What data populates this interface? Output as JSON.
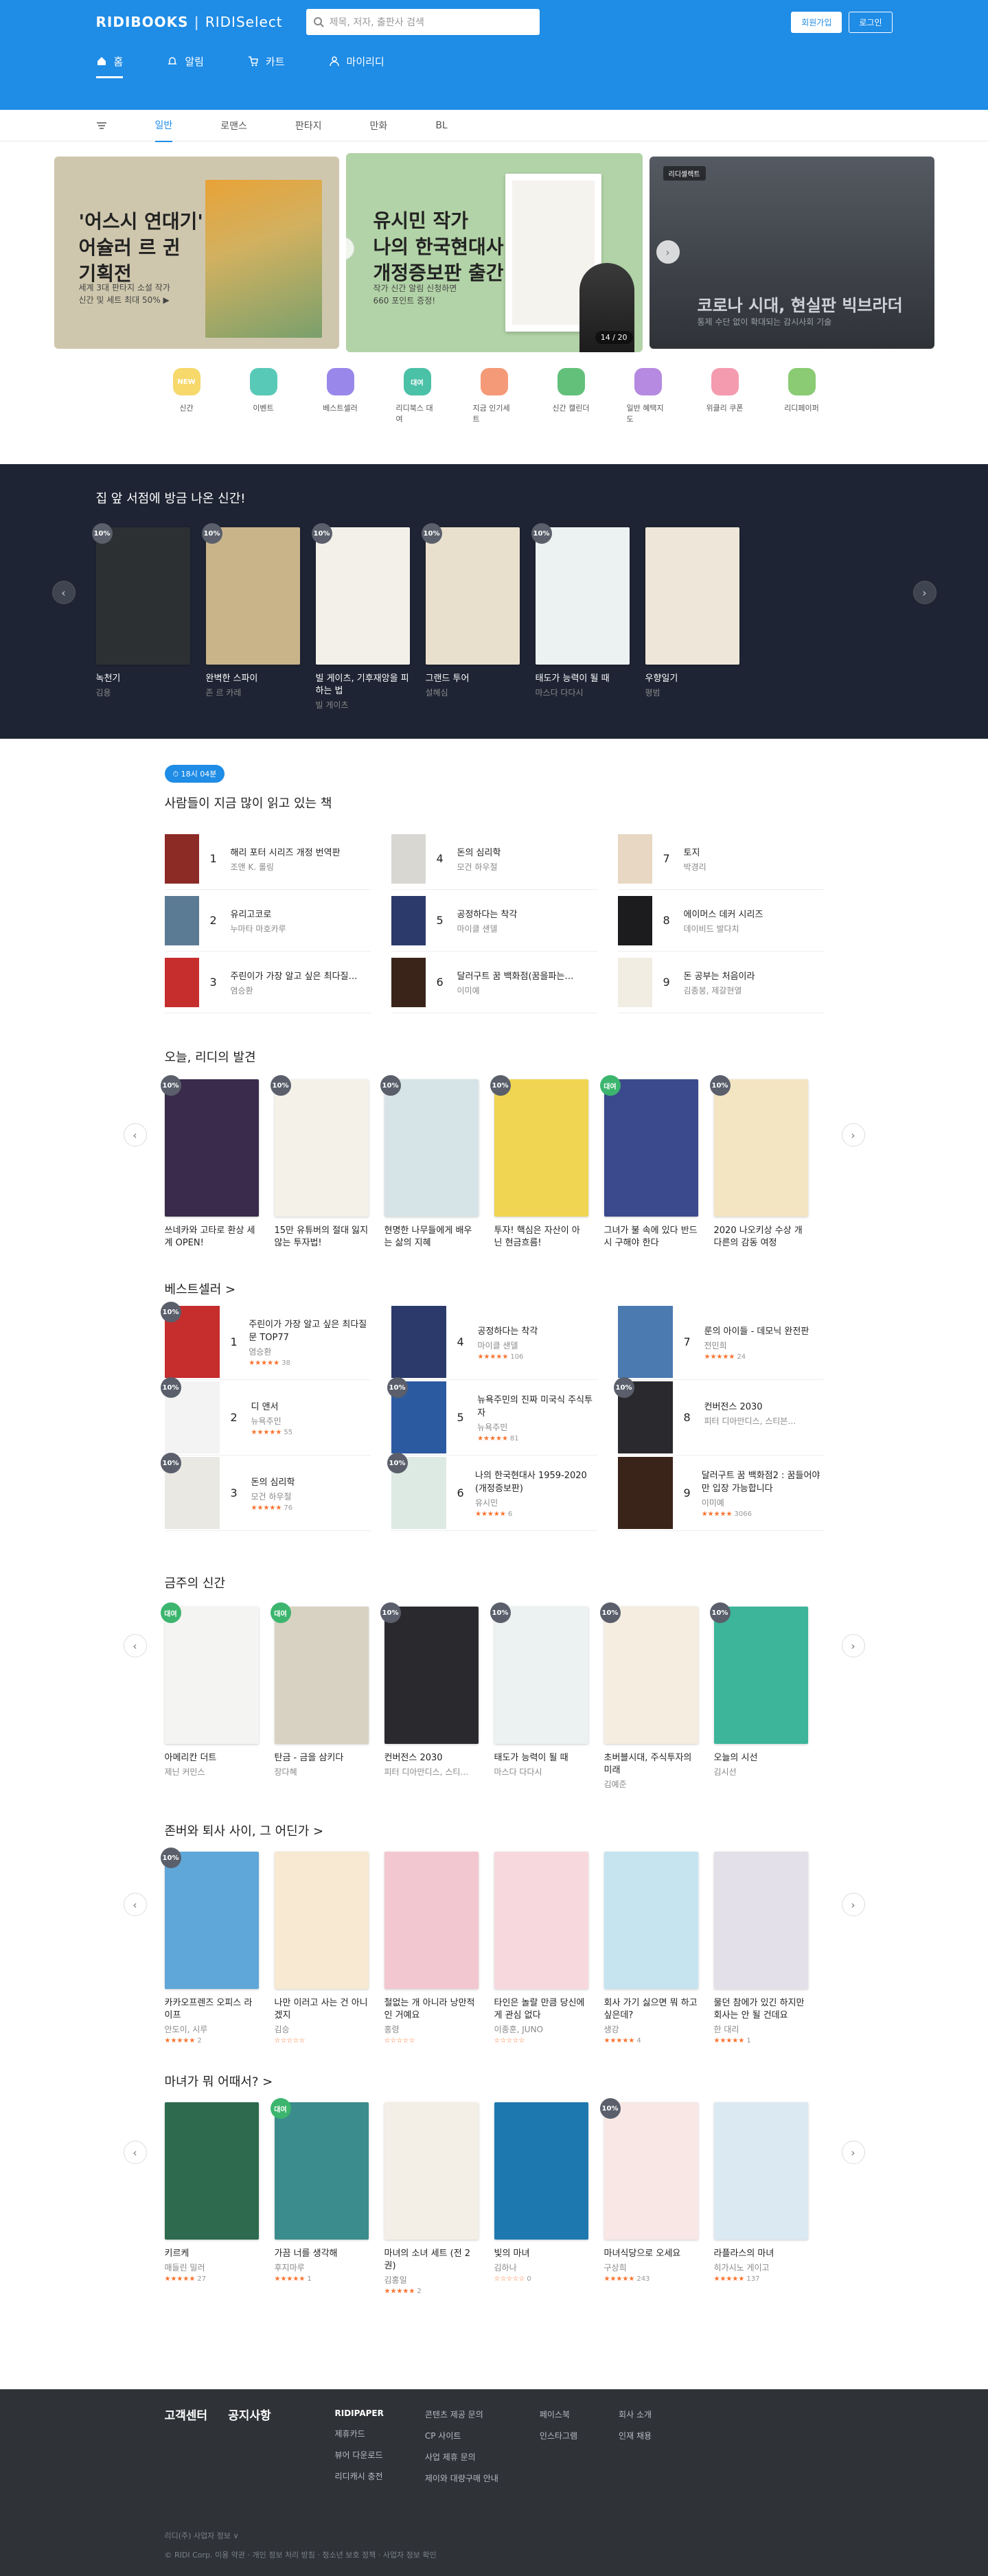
{
  "header": {
    "logo": "RIDIBOOKS",
    "logo2": "RIDISelect",
    "search_placeholder": "제목, 저자, 출판사 검색",
    "signup": "회원가입",
    "login": "로그인"
  },
  "gnb": [
    {
      "label": "홈",
      "icon": "home-icon"
    },
    {
      "label": "알림",
      "icon": "bell-icon"
    },
    {
      "label": "카트",
      "icon": "cart-icon"
    },
    {
      "label": "마이리디",
      "icon": "user-icon"
    }
  ],
  "subnav": [
    "일반",
    "로맨스",
    "판타지",
    "만화",
    "BL"
  ],
  "banner": {
    "s1_title": "'어스시 연대기'\n어슐러 르 귄\n기획전",
    "s1_desc": "세계 3대 판타지 소설 작가\n신간 및 세트 최대 50% ▶",
    "s2_title": "유시민 작가\n나의 한국현대사\n개정증보판 출간",
    "s2_desc": "작가 신간 알림 신청하면\n660 포인트 증정!",
    "s2_page": "14 / 20",
    "s3_tag": "리디셀렉트",
    "s3_title": "코로나 시대, 현실판 빅브라더",
    "s3_desc": "통제 수단 없이 확대되는 감시사회 기술"
  },
  "quick": [
    {
      "label": "신간",
      "icon": "new-icon",
      "color": "#f6d86b",
      "text": "NEW"
    },
    {
      "label": "이벤트",
      "icon": "gift-icon",
      "color": "#59c9b7",
      "text": ""
    },
    {
      "label": "베스트셀러",
      "icon": "medal-icon",
      "color": "#9a87ea",
      "text": ""
    },
    {
      "label": "리디북스 대여",
      "icon": "rent-icon",
      "color": "#4bc1a7",
      "text": "대여"
    },
    {
      "label": "지금 인기세트",
      "icon": "set-icon",
      "color": "#f59a78",
      "text": ""
    },
    {
      "label": "신간 캘린더",
      "icon": "calendar-icon",
      "color": "#63c07a",
      "text": ""
    },
    {
      "label": "일반 혜택지도",
      "icon": "map-icon",
      "color": "#b58ae0",
      "text": ""
    },
    {
      "label": "위클리 쿠폰",
      "icon": "coupon-icon",
      "color": "#f49bb0",
      "text": ""
    },
    {
      "label": "리디페이퍼",
      "icon": "paper-icon",
      "color": "#8acb73",
      "text": ""
    }
  ],
  "new_today": {
    "title": "집 앞 서점에 방금 나온 신간!",
    "books": [
      {
        "t": "녹천기",
        "a": "김용",
        "c": "#2d3033",
        "b": "10%"
      },
      {
        "t": "완벽한 스파이",
        "a": "존 르 카레",
        "c": "#c9b48a",
        "b": "10%"
      },
      {
        "t": "빌 게이츠, 기후재앙을 피하는 법",
        "a": "빌 게이츠",
        "c": "#f3f0ea",
        "b": "10%"
      },
      {
        "t": "그랜드 투어",
        "a": "설혜심",
        "c": "#e9dfcd",
        "b": "10%"
      },
      {
        "t": "태도가 능력이 될 때",
        "a": "마스다 다다시",
        "c": "#ecf1f1",
        "b": "10%"
      },
      {
        "t": "우향일기",
        "a": "평범",
        "c": "#eee6d8",
        "b": ""
      }
    ]
  },
  "ranking": {
    "time": "18시 04분",
    "title": "사람들이 지금 많이 읽고 있는 책",
    "items": [
      {
        "n": "1",
        "t": "해리 포터 시리즈 개정 번역판",
        "a": "조앤 K. 롤링",
        "c": "#8c2a26"
      },
      {
        "n": "4",
        "t": "돈의 심리학",
        "a": "모건 하우절",
        "c": "#d8d7d2"
      },
      {
        "n": "7",
        "t": "토지",
        "a": "박경리",
        "c": "#e8d7c2"
      },
      {
        "n": "2",
        "t": "유리고코로",
        "a": "누마타 마호카루",
        "c": "#5b7a93"
      },
      {
        "n": "5",
        "t": "공정하다는 착각",
        "a": "마이클 샌델",
        "c": "#2b3a6b"
      },
      {
        "n": "8",
        "t": "에이머스 데커 시리즈",
        "a": "데이비드 발다치",
        "c": "#1c1c1f"
      },
      {
        "n": "3",
        "t": "주린이가 가장 알고 싶은 최다질…",
        "a": "염승환",
        "c": "#c62d2d"
      },
      {
        "n": "6",
        "t": "달러구트 꿈 백화점(꿈을파는…",
        "a": "이미예",
        "c": "#3a2419"
      },
      {
        "n": "9",
        "t": "돈 공부는 처음이라",
        "a": "김종봉, 제갈현열",
        "c": "#f1ede3"
      }
    ]
  },
  "discover": {
    "title": "오늘, 리디의 발견",
    "books": [
      {
        "t": "쓰네카와 고타로 환상 세계 OPEN!",
        "c": "#3a2b4c",
        "b": "10%"
      },
      {
        "t": "15만 유튜버의 절대 잃지 않는 투자법!",
        "c": "#f4f1e8",
        "b": "10%"
      },
      {
        "t": "현명한 나무들에게 배우는 삶의 지혜",
        "c": "#d7e4e7",
        "b": "10%"
      },
      {
        "t": "투자! 핵심은 자산이 아닌 현금흐름!",
        "c": "#efd552",
        "b": "10%"
      },
      {
        "t": "그녀가 불 속에 있다 반드시 구해야 한다",
        "c": "#3b4a8c",
        "b": "대여"
      },
      {
        "t": "2020 나오키상 수상 개 다른의 감동 여정",
        "c": "#f3e4c2",
        "b": "10%"
      }
    ]
  },
  "best": {
    "title": "베스트셀러 >",
    "items": [
      {
        "n": "1",
        "t": "주린이가 가장 알고 싶은 최다질문 TOP77",
        "a": "염승환",
        "s": "★★★★★",
        "r": "38",
        "c": "#c62d2d",
        "b": "10%"
      },
      {
        "n": "4",
        "t": "공정하다는 착각",
        "a": "마이클 샌델",
        "s": "★★★★★",
        "r": "106",
        "c": "#2b3a6b",
        "b": ""
      },
      {
        "n": "7",
        "t": "룬의 아이들 - 데모닉 완전판",
        "a": "전민희",
        "s": "★★★★★",
        "r": "24",
        "c": "#4a7ab0",
        "b": ""
      },
      {
        "n": "2",
        "t": "디 앤서",
        "a": "뉴욕주민",
        "s": "★★★★★",
        "r": "55",
        "c": "#f3f3f3",
        "b": "10%"
      },
      {
        "n": "5",
        "t": "뉴욕주민의 진짜 미국식 주식투자",
        "a": "뉴욕주민",
        "s": "★★★★★",
        "r": "81",
        "c": "#2c5aa0",
        "b": "10%"
      },
      {
        "n": "8",
        "t": "컨버전스 2030",
        "a": "피터 디아만디스, 스티븐…",
        "s": "",
        "r": "",
        "c": "#2a2a2e",
        "b": "10%"
      },
      {
        "n": "3",
        "t": "돈의 심리학",
        "a": "모건 하우절",
        "s": "★★★★★",
        "r": "76",
        "c": "#e9e8e2",
        "b": "10%"
      },
      {
        "n": "6",
        "t": "나의 한국현대사 1959-2020 (개정증보판)",
        "a": "유시민",
        "s": "★★★★★",
        "r": "6",
        "c": "#dde9e3",
        "b": "10%"
      },
      {
        "n": "9",
        "t": "달러구트 꿈 백화점2 : 꿈들어야만 입장 가능합니다",
        "a": "이미예",
        "s": "★★★★★",
        "r": "3066",
        "c": "#3a2419",
        "b": ""
      }
    ]
  },
  "weekly_new": {
    "title": "금주의 신간",
    "books": [
      {
        "t": "아메리칸 더트",
        "a": "제닌 커민스",
        "c": "#f4f4f2",
        "b": "대여"
      },
      {
        "t": "탄금 - 금을 삼키다",
        "a": "장다혜",
        "c": "#d8d2c2",
        "b": "대여"
      },
      {
        "t": "컨버전스 2030",
        "a": "피터 디아만디스, 스티…",
        "c": "#2a2a2e",
        "b": "10%"
      },
      {
        "t": "태도가 능력이 될 때",
        "a": "마스다 다다시",
        "c": "#ecf1f1",
        "b": "10%"
      },
      {
        "t": "초버블시대, 주식투자의 미래",
        "a": "김예준",
        "c": "#f4ede0",
        "b": "10%"
      },
      {
        "t": "오늘의 시선",
        "a": "김시선",
        "c": "#3cb59a",
        "b": "10%"
      }
    ]
  },
  "between": {
    "title": "존버와 퇴사 사이, 그 어딘가 >",
    "books": [
      {
        "t": "카카오프렌즈 오피스 라이프",
        "a": "안도이, 시루",
        "s": "★★★★★",
        "r": "2",
        "c": "#5fa7d8",
        "b": "10%"
      },
      {
        "t": "나만 이러고 사는 건 아니겠지",
        "a": "김승",
        "s": "☆☆☆☆☆",
        "r": "",
        "c": "#f7e9d2",
        "b": ""
      },
      {
        "t": "철없는 개 아니라 낭만적인 거예요",
        "a": "홍령",
        "s": "☆☆☆☆☆",
        "r": "",
        "c": "#f3c7d0",
        "b": ""
      },
      {
        "t": "타인은 놀랄 만큼 당신에게 관심 없다",
        "a": "이종훈, JUNO",
        "s": "☆☆☆☆☆",
        "r": "",
        "c": "#f7d9dd",
        "b": ""
      },
      {
        "t": "회사 가기 싫으면 뭐 하고 싶은데?",
        "a": "생강",
        "s": "★★★★★",
        "r": "4",
        "c": "#c5e4f0",
        "b": ""
      },
      {
        "t": "물던 참에가 있긴 하지만 회사는 안 될 건데요",
        "a": "한 대리",
        "s": "★★★★★",
        "r": "1",
        "c": "#e4e0ea",
        "b": ""
      }
    ]
  },
  "witch": {
    "title": "마녀가 뭐 어때서? >",
    "books": [
      {
        "t": "키르케",
        "a": "매들린 밀러",
        "s": "★★★★★",
        "r": "27",
        "c": "#2d6a4e",
        "b": ""
      },
      {
        "t": "가끔 너를 생각해",
        "a": "후지마루",
        "s": "★★★★★",
        "r": "1",
        "c": "#3b8c8c",
        "b": "대여"
      },
      {
        "t": "마녀의 소녀 세트 (전 2권)",
        "a": "김홍일",
        "s": "★★★★★",
        "r": "2",
        "c": "#f4efe6",
        "b": ""
      },
      {
        "t": "빛의 마녀",
        "a": "김하나",
        "s": "☆☆☆☆☆",
        "r": "0",
        "c": "#1e78b0",
        "b": ""
      },
      {
        "t": "마녀식당으로 오세요",
        "a": "구상희",
        "s": "★★★★★",
        "r": "243",
        "c": "#f8e7e4",
        "b": "10%"
      },
      {
        "t": "라플라스의 마녀",
        "a": "히가시노 게이고",
        "s": "★★★★★",
        "r": "137",
        "c": "#dbe9f2",
        "b": ""
      }
    ]
  },
  "footer": {
    "cs": "고객센터",
    "notice": "공지사항",
    "col1": [
      "RIDIPAPER",
      "제휴카드",
      "뷰어 다운로드",
      "리디캐시 충전"
    ],
    "col2": [
      "콘텐츠 제공 문의",
      "CP 사이트",
      "사업 제휴 문의",
      "제이와 대량구매 안내"
    ],
    "col3": [
      "페이스북",
      "인스타그램"
    ],
    "col4": [
      "회사 소개",
      "인재 채용"
    ],
    "company": "리디(주) 사업자 정보 ∨",
    "copy": "© RIDI Corp.    이용 약관  ·  개인 정보 처리 방침  ·  청소년 보호 정책  ·  사업자 정보 확인"
  }
}
